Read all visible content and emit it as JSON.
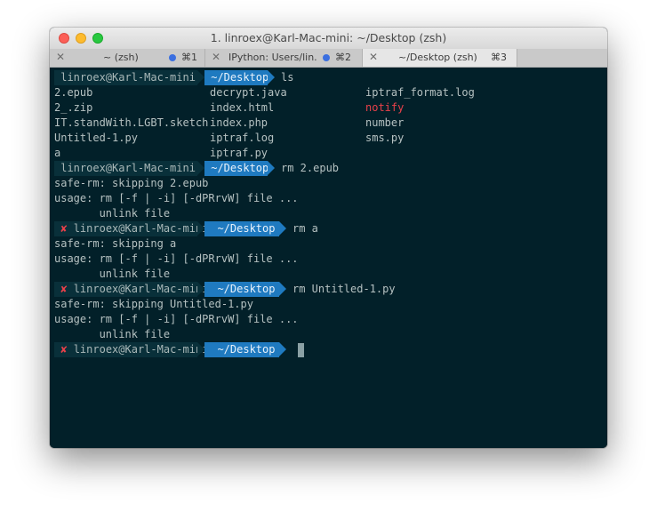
{
  "window": {
    "title": "1. linroex@Karl-Mac-mini: ~/Desktop (zsh)"
  },
  "tabs": [
    {
      "label": "~ (zsh)",
      "shortcut": "⌘1",
      "dot_color": "#3b6fe0"
    },
    {
      "label": "IPython: Users/lin...",
      "shortcut": "⌘2",
      "dot_color": "#3b6fe0"
    },
    {
      "label": "~/Desktop (zsh)",
      "shortcut": "⌘3",
      "dot_color": ""
    }
  ],
  "prompt": {
    "user": "linroex@Karl-Mac-mini",
    "dir": "~/Desktop",
    "error_mark": "✘"
  },
  "commands": [
    {
      "cmd": "ls"
    },
    {
      "cmd": "rm 2.epub"
    },
    {
      "cmd": "rm a"
    },
    {
      "cmd": "rm Untitled-1.py"
    }
  ],
  "ls_output": [
    [
      "2.epub",
      "decrypt.java",
      "iptraf_format.log"
    ],
    [
      "2_.zip",
      "index.html",
      "notify"
    ],
    [
      "IT.standWith.LGBT.sketch",
      "index.php",
      "number"
    ],
    [
      "Untitled-1.py",
      "iptraf.log",
      "sms.py"
    ],
    [
      "a",
      "iptraf.py",
      ""
    ]
  ],
  "outputs": [
    [
      "safe-rm: skipping 2.epub",
      "usage: rm [-f | -i] [-dPRrvW] file ...",
      "       unlink file"
    ],
    [
      "safe-rm: skipping a",
      "usage: rm [-f | -i] [-dPRrvW] file ...",
      "       unlink file"
    ],
    [
      "safe-rm: skipping Untitled-1.py",
      "usage: rm [-f | -i] [-dPRrvW] file ...",
      "       unlink file"
    ]
  ],
  "colors": {
    "background": "#022029",
    "dir_segment": "#1f7ac0",
    "error": "#e8414a"
  }
}
